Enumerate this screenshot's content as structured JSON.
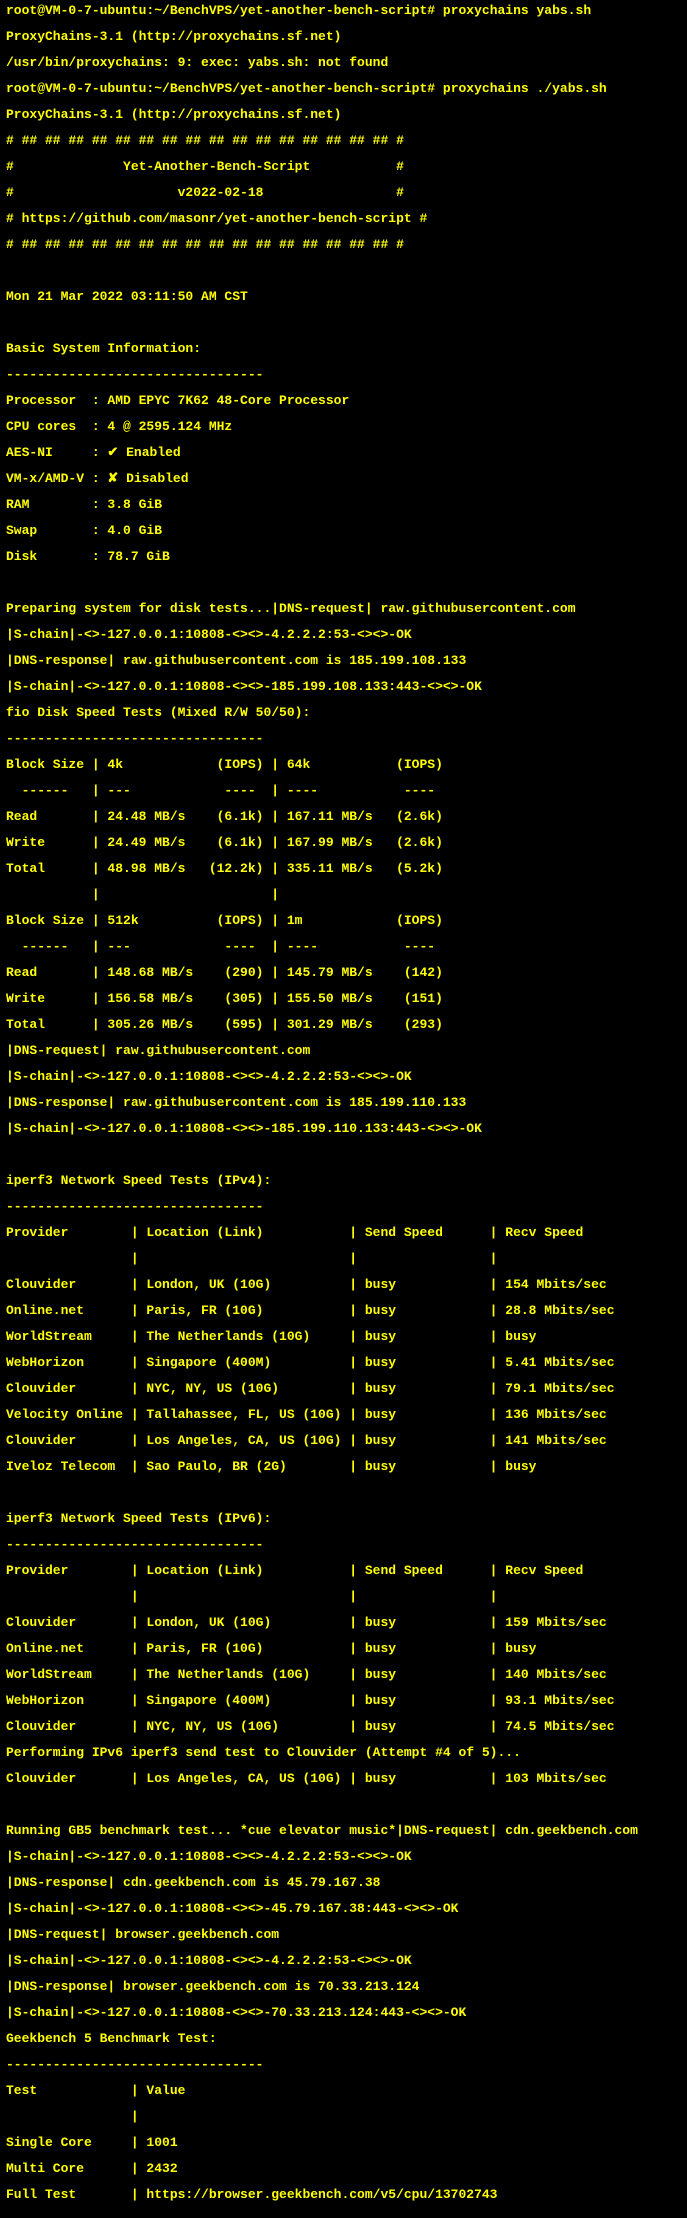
{
  "prompt1": "root@VM-0-7-ubuntu:~/BenchVPS/yet-another-bench-script#",
  "cmd1": "proxychains yabs.sh",
  "pc_ver": "ProxyChains-3.1 (http://proxychains.sf.net)",
  "err1": "/usr/bin/proxychains: 9: exec: yabs.sh: not found",
  "cmd2": "proxychains ./yabs.sh",
  "banner": {
    "b1": "# ## ## ## ## ## ## ## ## ## ## ## ## ## ## ## ## #",
    "b2": "#              Yet-Another-Bench-Script           #",
    "b3": "#                     v2022-02-18                 #",
    "b4": "# https://github.com/masonr/yet-another-bench-script #",
    "b5": "# ## ## ## ## ## ## ## ## ## ## ## ## ## ## ## ## #"
  },
  "date": "Mon 21 Mar 2022 03:11:50 AM CST",
  "sys": {
    "hdr": "Basic System Information:",
    "sep": "---------------------------------",
    "cpu": "Processor  : AMD EPYC 7K62 48-Core Processor",
    "cores": "CPU cores  : 4 @ 2595.124 MHz",
    "aes": "AES-NI     : ✔ Enabled",
    "vmx": "VM-x/AMD-V : ✘ Disabled",
    "ram": "RAM        : 3.8 GiB",
    "swap": "Swap       : 4.0 GiB",
    "disk": "Disk       : 78.7 GiB"
  },
  "disk": {
    "prep": "Preparing system for disk tests...|DNS-request| raw.githubusercontent.com",
    "sc1": "|S-chain|-<>-127.0.0.1:10808-<><>-4.2.2.2:53-<><>-OK",
    "dns1": "|DNS-response| raw.githubusercontent.com is 185.199.108.133",
    "sc2": "|S-chain|-<>-127.0.0.1:10808-<><>-185.199.108.133:443-<><>-OK",
    "title": "fio Disk Speed Tests (Mixed R/W 50/50):",
    "sep": "---------------------------------",
    "h1": "Block Size | 4k            (IOPS) | 64k           (IOPS)",
    "h1s": "  ------   | ---            ----  | ----           ----",
    "r1": "Read       | 24.48 MB/s    (6.1k) | 167.11 MB/s   (2.6k)",
    "r2": "Write      | 24.49 MB/s    (6.1k) | 167.99 MB/s   (2.6k)",
    "r3": "Total      | 48.98 MB/s   (12.2k) | 335.11 MB/s   (5.2k)",
    "blank": "           |                      |",
    "h2": "Block Size | 512k          (IOPS) | 1m            (IOPS)",
    "h2s": "  ------   | ---            ----  | ----           ----",
    "r4": "Read       | 148.68 MB/s    (290) | 145.79 MB/s    (142)",
    "r5": "Write      | 156.58 MB/s    (305) | 155.50 MB/s    (151)",
    "r6": "Total      | 305.26 MB/s    (595) | 301.29 MB/s    (293)",
    "dns2": "|DNS-request| raw.githubusercontent.com",
    "sc3": "|S-chain|-<>-127.0.0.1:10808-<><>-4.2.2.2:53-<><>-OK",
    "dns3": "|DNS-response| raw.githubusercontent.com is 185.199.110.133",
    "sc4": "|S-chain|-<>-127.0.0.1:10808-<><>-185.199.110.133:443-<><>-OK"
  },
  "ipv4": {
    "title": "iperf3 Network Speed Tests (IPv4):",
    "sep": "---------------------------------",
    "hdr": "Provider        | Location (Link)           | Send Speed      | Recv Speed",
    "hs": "                |                           |                 |",
    "r1": "Clouvider       | London, UK (10G)          | busy            | 154 Mbits/sec",
    "r2": "Online.net      | Paris, FR (10G)           | busy            | 28.8 Mbits/sec",
    "r3": "WorldStream     | The Netherlands (10G)     | busy            | busy",
    "r4": "WebHorizon      | Singapore (400M)          | busy            | 5.41 Mbits/sec",
    "r5": "Clouvider       | NYC, NY, US (10G)         | busy            | 79.1 Mbits/sec",
    "r6": "Velocity Online | Tallahassee, FL, US (10G) | busy            | 136 Mbits/sec",
    "r7": "Clouvider       | Los Angeles, CA, US (10G) | busy            | 141 Mbits/sec",
    "r8": "Iveloz Telecom  | Sao Paulo, BR (2G)        | busy            | busy"
  },
  "ipv6": {
    "title": "iperf3 Network Speed Tests (IPv6):",
    "sep": "---------------------------------",
    "hdr": "Provider        | Location (Link)           | Send Speed      | Recv Speed",
    "hs": "                |                           |                 |",
    "r1": "Clouvider       | London, UK (10G)          | busy            | 159 Mbits/sec",
    "r2": "Online.net      | Paris, FR (10G)           | busy            | busy",
    "r3": "WorldStream     | The Netherlands (10G)     | busy            | 140 Mbits/sec",
    "r4": "WebHorizon      | Singapore (400M)          | busy            | 93.1 Mbits/sec",
    "r5": "Clouvider       | NYC, NY, US (10G)         | busy            | 74.5 Mbits/sec",
    "r6": "Performing IPv6 iperf3 send test to Clouvider (Attempt #4 of 5)...",
    "r7": "Clouvider       | Los Angeles, CA, US (10G) | busy            | 103 Mbits/sec"
  },
  "gb": {
    "run": "Running GB5 benchmark test... *cue elevator music*|DNS-request| cdn.geekbench.com",
    "sc1": "|S-chain|-<>-127.0.0.1:10808-<><>-4.2.2.2:53-<><>-OK",
    "dns1": "|DNS-response| cdn.geekbench.com is 45.79.167.38",
    "sc2": "|S-chain|-<>-127.0.0.1:10808-<><>-45.79.167.38:443-<><>-OK",
    "dns2": "|DNS-request| browser.geekbench.com",
    "sc3": "|S-chain|-<>-127.0.0.1:10808-<><>-4.2.2.2:53-<><>-OK",
    "dns3": "|DNS-response| browser.geekbench.com is 70.33.213.124",
    "sc4": "|S-chain|-<>-127.0.0.1:10808-<><>-70.33.213.124:443-<><>-OK",
    "title": "Geekbench 5 Benchmark Test:",
    "sep": "---------------------------------",
    "hdr": "Test            | Value",
    "hs": "                |",
    "r1": "Single Core     | 1001",
    "r2": "Multi Core      | 2432",
    "r3": "Full Test       | https://browser.geekbench.com/v5/cpu/13702743"
  }
}
